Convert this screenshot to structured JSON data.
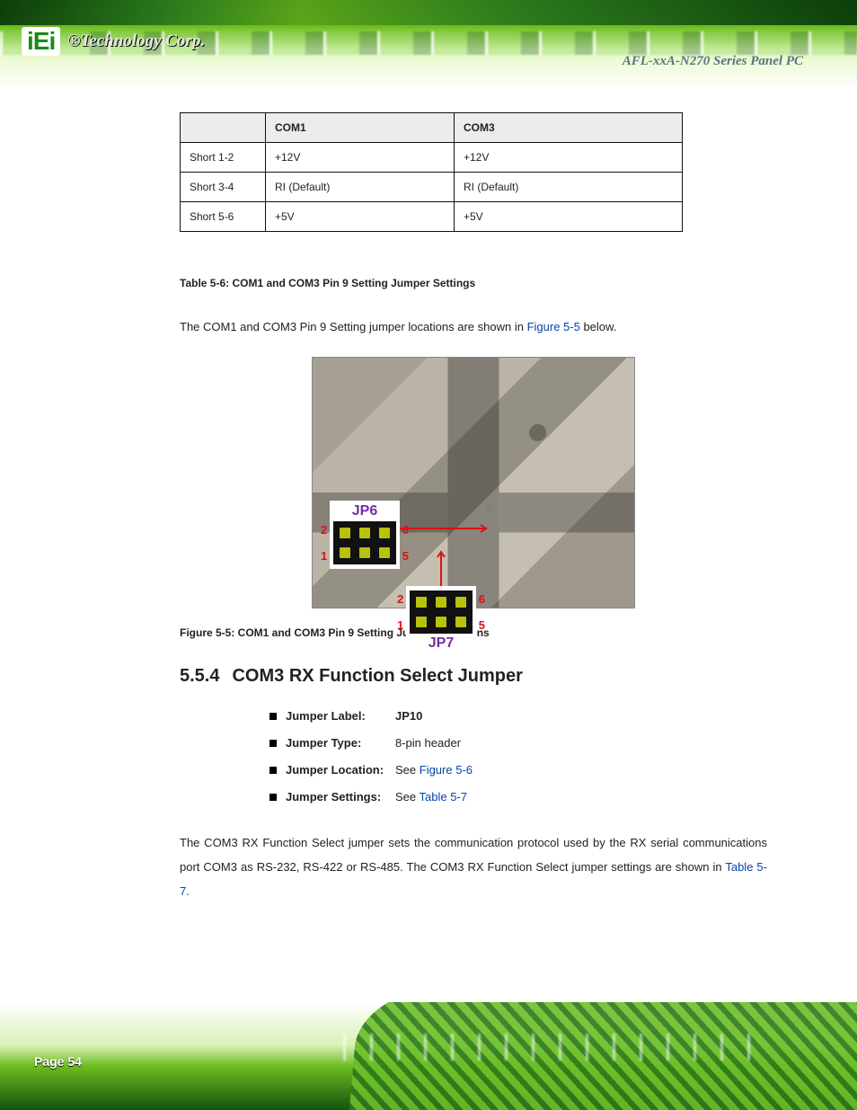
{
  "brand": {
    "mark": "iEi",
    "name": "®Technology Corp."
  },
  "header_right": "AFL-xxA-N270 Series Panel PC",
  "table5_6": {
    "headers": [
      "",
      "COM1",
      "COM3"
    ],
    "rows": [
      [
        "Short 1-2",
        "+12V",
        "+12V"
      ],
      [
        "Short 3-4",
        "RI (Default)",
        "RI (Default)"
      ],
      [
        "Short 5-6",
        "+5V",
        "+5V"
      ]
    ],
    "caption": "Table 5-6: COM1 and COM3 Pin 9 Setting Jumper Settings"
  },
  "para1_a": "The COM1 and COM3 Pin 9 Setting jumper locations are shown in ",
  "para1_link": "Figure 5-5",
  "para1_b": " below.",
  "jp6": {
    "label": "JP6",
    "tl": "2",
    "tr": "6",
    "bl": "1",
    "br": "5"
  },
  "jp7": {
    "label": "JP7",
    "tl": "2",
    "tr": "6",
    "bl": "1",
    "br": "5"
  },
  "figure5_5_caption": "Figure 5-5: COM1 and COM3 Pin 9 Setting Jumper Locations",
  "section": {
    "number": "5.5.4",
    "title": "COM3 RX Function Select Jumper"
  },
  "specs": {
    "label_label": "Jumper Label:",
    "label_value": "JP10",
    "type_label": "Jumper Type:",
    "type_value": "8-pin header",
    "loc_label": "Jumper Location:",
    "loc_value_a": "See ",
    "loc_value_link": "Figure 5-6",
    "set_label": "Jumper Settings:",
    "set_value_a": "See ",
    "set_value_link": "Table 5-7"
  },
  "para2_a": "The COM3 RX Function Select jumper sets the communication protocol used by the RX serial communications port COM3 as RS-232, RS-422 or RS-485. The COM3 RX Function Select jumper settings are shown in ",
  "para2_link": "Table 5-7",
  "para2_b": ".",
  "page_number": "Page 54"
}
